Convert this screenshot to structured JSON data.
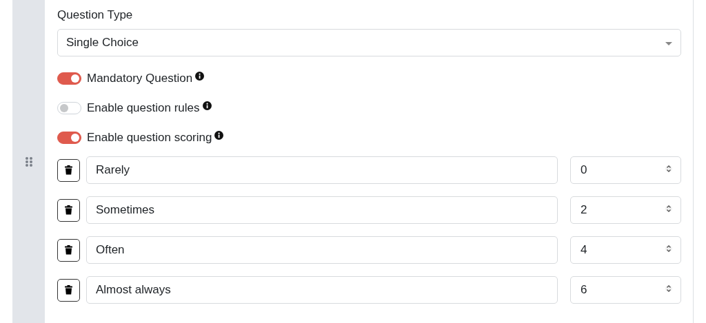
{
  "question_type": {
    "label": "Question Type",
    "value": "Single Choice"
  },
  "toggles": [
    {
      "label": "Mandatory Question",
      "on": true
    },
    {
      "label": "Enable question rules",
      "on": false
    },
    {
      "label": "Enable question scoring",
      "on": true
    }
  ],
  "options": [
    {
      "text": "Rarely",
      "score": "0"
    },
    {
      "text": "Sometimes",
      "score": "2"
    },
    {
      "text": "Often",
      "score": "4"
    },
    {
      "text": "Almost always",
      "score": "6"
    }
  ]
}
